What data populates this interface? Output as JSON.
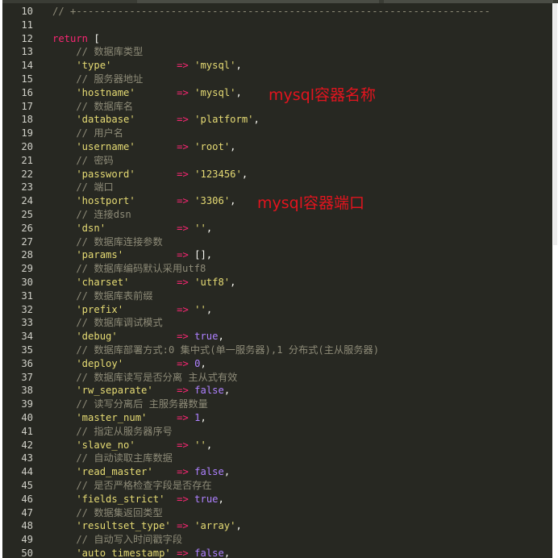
{
  "editor": {
    "lines": [
      {
        "n": "10",
        "tokens": [
          [
            "c-comment",
            "// +----------------------------------------------------------------------"
          ]
        ]
      },
      {
        "n": "11",
        "tokens": []
      },
      {
        "n": "12",
        "tokens": [
          [
            "c-kw",
            "return"
          ],
          [
            "c-punc",
            " ["
          ]
        ]
      },
      {
        "n": "13",
        "tokens": [
          [
            "c-comment",
            "    // 数据库类型"
          ]
        ]
      },
      {
        "n": "14",
        "tokens": [
          [
            "c-str",
            "    'type'"
          ],
          [
            "c-punc",
            "           "
          ],
          [
            "c-op",
            "=>"
          ],
          [
            "c-punc",
            " "
          ],
          [
            "c-str",
            "'mysql'"
          ],
          [
            "c-punc",
            ","
          ]
        ]
      },
      {
        "n": "15",
        "tokens": [
          [
            "c-comment",
            "    // 服务器地址"
          ]
        ]
      },
      {
        "n": "16",
        "tokens": [
          [
            "c-str",
            "    'hostname'"
          ],
          [
            "c-punc",
            "       "
          ],
          [
            "c-op",
            "=>"
          ],
          [
            "c-punc",
            " "
          ],
          [
            "c-str",
            "'mysql'"
          ],
          [
            "c-punc",
            ","
          ]
        ]
      },
      {
        "n": "17",
        "tokens": [
          [
            "c-comment",
            "    // 数据库名"
          ]
        ]
      },
      {
        "n": "18",
        "tokens": [
          [
            "c-str",
            "    'database'"
          ],
          [
            "c-punc",
            "       "
          ],
          [
            "c-op",
            "=>"
          ],
          [
            "c-punc",
            " "
          ],
          [
            "c-str",
            "'platform'"
          ],
          [
            "c-punc",
            ","
          ]
        ]
      },
      {
        "n": "19",
        "tokens": [
          [
            "c-comment",
            "    // 用户名"
          ]
        ]
      },
      {
        "n": "20",
        "tokens": [
          [
            "c-str",
            "    'username'"
          ],
          [
            "c-punc",
            "       "
          ],
          [
            "c-op",
            "=>"
          ],
          [
            "c-punc",
            " "
          ],
          [
            "c-str",
            "'root'"
          ],
          [
            "c-punc",
            ","
          ]
        ]
      },
      {
        "n": "21",
        "tokens": [
          [
            "c-comment",
            "    // 密码"
          ]
        ]
      },
      {
        "n": "22",
        "tokens": [
          [
            "c-str",
            "    'password'"
          ],
          [
            "c-punc",
            "       "
          ],
          [
            "c-op",
            "=>"
          ],
          [
            "c-punc",
            " "
          ],
          [
            "c-str",
            "'123456'"
          ],
          [
            "c-punc",
            ","
          ]
        ]
      },
      {
        "n": "23",
        "tokens": [
          [
            "c-comment",
            "    // 端口"
          ]
        ]
      },
      {
        "n": "24",
        "tokens": [
          [
            "c-str",
            "    'hostport'"
          ],
          [
            "c-punc",
            "       "
          ],
          [
            "c-op",
            "=>"
          ],
          [
            "c-punc",
            " "
          ],
          [
            "c-str",
            "'3306'"
          ],
          [
            "c-punc",
            ","
          ]
        ]
      },
      {
        "n": "25",
        "tokens": [
          [
            "c-comment",
            "    // 连接dsn"
          ]
        ]
      },
      {
        "n": "26",
        "tokens": [
          [
            "c-str",
            "    'dsn'"
          ],
          [
            "c-punc",
            "            "
          ],
          [
            "c-op",
            "=>"
          ],
          [
            "c-punc",
            " "
          ],
          [
            "c-str",
            "''"
          ],
          [
            "c-punc",
            ","
          ]
        ]
      },
      {
        "n": "27",
        "tokens": [
          [
            "c-comment",
            "    // 数据库连接参数"
          ]
        ]
      },
      {
        "n": "28",
        "tokens": [
          [
            "c-str",
            "    'params'"
          ],
          [
            "c-punc",
            "         "
          ],
          [
            "c-op",
            "=>"
          ],
          [
            "c-punc",
            " [],"
          ]
        ]
      },
      {
        "n": "29",
        "tokens": [
          [
            "c-comment",
            "    // 数据库编码默认采用utf8"
          ]
        ]
      },
      {
        "n": "30",
        "tokens": [
          [
            "c-str",
            "    'charset'"
          ],
          [
            "c-punc",
            "        "
          ],
          [
            "c-op",
            "=>"
          ],
          [
            "c-punc",
            " "
          ],
          [
            "c-str",
            "'utf8'"
          ],
          [
            "c-punc",
            ","
          ]
        ]
      },
      {
        "n": "31",
        "tokens": [
          [
            "c-comment",
            "    // 数据库表前缀"
          ]
        ]
      },
      {
        "n": "32",
        "tokens": [
          [
            "c-str",
            "    'prefix'"
          ],
          [
            "c-punc",
            "         "
          ],
          [
            "c-op",
            "=>"
          ],
          [
            "c-punc",
            " "
          ],
          [
            "c-str",
            "''"
          ],
          [
            "c-punc",
            ","
          ]
        ]
      },
      {
        "n": "33",
        "tokens": [
          [
            "c-comment",
            "    // 数据库调试模式"
          ]
        ]
      },
      {
        "n": "34",
        "tokens": [
          [
            "c-str",
            "    'debug'"
          ],
          [
            "c-punc",
            "          "
          ],
          [
            "c-op",
            "=>"
          ],
          [
            "c-punc",
            " "
          ],
          [
            "c-const",
            "true"
          ],
          [
            "c-punc",
            ","
          ]
        ]
      },
      {
        "n": "35",
        "tokens": [
          [
            "c-comment",
            "    // 数据库部署方式:0 集中式(单一服务器),1 分布式(主从服务器)"
          ]
        ]
      },
      {
        "n": "36",
        "tokens": [
          [
            "c-str",
            "    'deploy'"
          ],
          [
            "c-punc",
            "         "
          ],
          [
            "c-op",
            "=>"
          ],
          [
            "c-punc",
            " "
          ],
          [
            "c-const",
            "0"
          ],
          [
            "c-punc",
            ","
          ]
        ]
      },
      {
        "n": "37",
        "tokens": [
          [
            "c-comment",
            "    // 数据库读写是否分离 主从式有效"
          ]
        ]
      },
      {
        "n": "38",
        "tokens": [
          [
            "c-str",
            "    'rw_separate'"
          ],
          [
            "c-punc",
            "    "
          ],
          [
            "c-op",
            "=>"
          ],
          [
            "c-punc",
            " "
          ],
          [
            "c-const",
            "false"
          ],
          [
            "c-punc",
            ","
          ]
        ]
      },
      {
        "n": "39",
        "tokens": [
          [
            "c-comment",
            "    // 读写分离后 主服务器数量"
          ]
        ]
      },
      {
        "n": "40",
        "tokens": [
          [
            "c-str",
            "    'master_num'"
          ],
          [
            "c-punc",
            "     "
          ],
          [
            "c-op",
            "=>"
          ],
          [
            "c-punc",
            " "
          ],
          [
            "c-const",
            "1"
          ],
          [
            "c-punc",
            ","
          ]
        ]
      },
      {
        "n": "41",
        "tokens": [
          [
            "c-comment",
            "    // 指定从服务器序号"
          ]
        ]
      },
      {
        "n": "42",
        "tokens": [
          [
            "c-str",
            "    'slave_no'"
          ],
          [
            "c-punc",
            "       "
          ],
          [
            "c-op",
            "=>"
          ],
          [
            "c-punc",
            " "
          ],
          [
            "c-str",
            "''"
          ],
          [
            "c-punc",
            ","
          ]
        ]
      },
      {
        "n": "43",
        "tokens": [
          [
            "c-comment",
            "    // 自动读取主库数据"
          ]
        ]
      },
      {
        "n": "44",
        "tokens": [
          [
            "c-str",
            "    'read_master'"
          ],
          [
            "c-punc",
            "    "
          ],
          [
            "c-op",
            "=>"
          ],
          [
            "c-punc",
            " "
          ],
          [
            "c-const",
            "false"
          ],
          [
            "c-punc",
            ","
          ]
        ]
      },
      {
        "n": "45",
        "tokens": [
          [
            "c-comment",
            "    // 是否严格检查字段是否存在"
          ]
        ]
      },
      {
        "n": "46",
        "tokens": [
          [
            "c-str",
            "    'fields_strict'"
          ],
          [
            "c-punc",
            "  "
          ],
          [
            "c-op",
            "=>"
          ],
          [
            "c-punc",
            " "
          ],
          [
            "c-const",
            "true"
          ],
          [
            "c-punc",
            ","
          ]
        ]
      },
      {
        "n": "47",
        "tokens": [
          [
            "c-comment",
            "    // 数据集返回类型"
          ]
        ]
      },
      {
        "n": "48",
        "tokens": [
          [
            "c-str",
            "    'resultset_type'"
          ],
          [
            "c-punc",
            " "
          ],
          [
            "c-op",
            "=>"
          ],
          [
            "c-punc",
            " "
          ],
          [
            "c-str",
            "'array'"
          ],
          [
            "c-punc",
            ","
          ]
        ]
      },
      {
        "n": "49",
        "tokens": [
          [
            "c-comment",
            "    // 自动写入时间戳字段"
          ]
        ]
      },
      {
        "n": "50",
        "tokens": [
          [
            "c-str",
            "    'auto_timestamp'"
          ],
          [
            "c-punc",
            " "
          ],
          [
            "c-op",
            "=>"
          ],
          [
            "c-punc",
            " "
          ],
          [
            "c-const",
            "false"
          ],
          [
            "c-punc",
            ","
          ]
        ]
      }
    ]
  },
  "annotations": {
    "hostname_note": "mysql容器名称",
    "hostport_note": "mysql容器端口"
  },
  "colors": {
    "background": "#272822",
    "comment": "#8e8b78",
    "keyword": "#f92672",
    "string": "#e6db74",
    "constant": "#ae81ff",
    "annotation": "#e2141e"
  }
}
